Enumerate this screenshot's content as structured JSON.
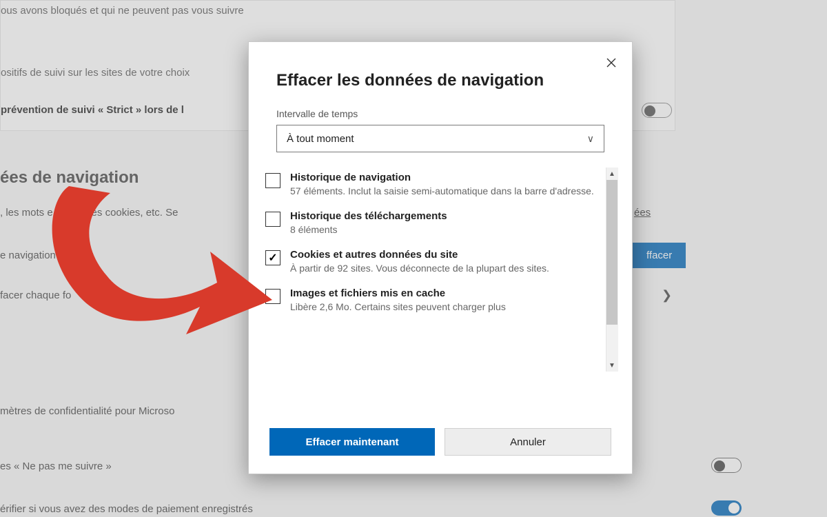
{
  "background": {
    "blocked_line": "ous avons bloqués et qui ne peuvent pas vous suivre",
    "tracking_line": "ositifs de suivi sur les sites de votre choix",
    "strict_line": "prévention de suivi « Strict » lors de l",
    "section_heading": "ées de navigation",
    "desc_line": ", les mots    e passe, les cookies, etc. Se",
    "clear_now_line": "e navigation      ntenant",
    "each_close_line": "facer chaque fo",
    "privacy_line": "mètres de confidentialité pour Microso",
    "dnt_line": "es « Ne pas me suivre »",
    "payment_line": "érifier si vous avez des modes de paiement enregistrés",
    "link_fragment": "ées",
    "clear_button": "ffacer"
  },
  "modal": {
    "title": "Effacer les données de navigation",
    "time_label": "Intervalle de temps",
    "time_value": "À tout moment",
    "options": [
      {
        "checked": false,
        "title": "Historique de navigation",
        "desc": "57 éléments. Inclut la saisie semi-automatique dans la barre d'adresse."
      },
      {
        "checked": false,
        "title": "Historique des téléchargements",
        "desc": "8 éléments"
      },
      {
        "checked": true,
        "title": "Cookies et autres données du site",
        "desc": "À partir de 92 sites. Vous déconnecte de la plupart des sites."
      },
      {
        "checked": false,
        "title": "Images et fichiers mis en cache",
        "desc": "Libère 2,6 Mo. Certains sites peuvent charger plus"
      }
    ],
    "primary_btn": "Effacer maintenant",
    "secondary_btn": "Annuler"
  }
}
